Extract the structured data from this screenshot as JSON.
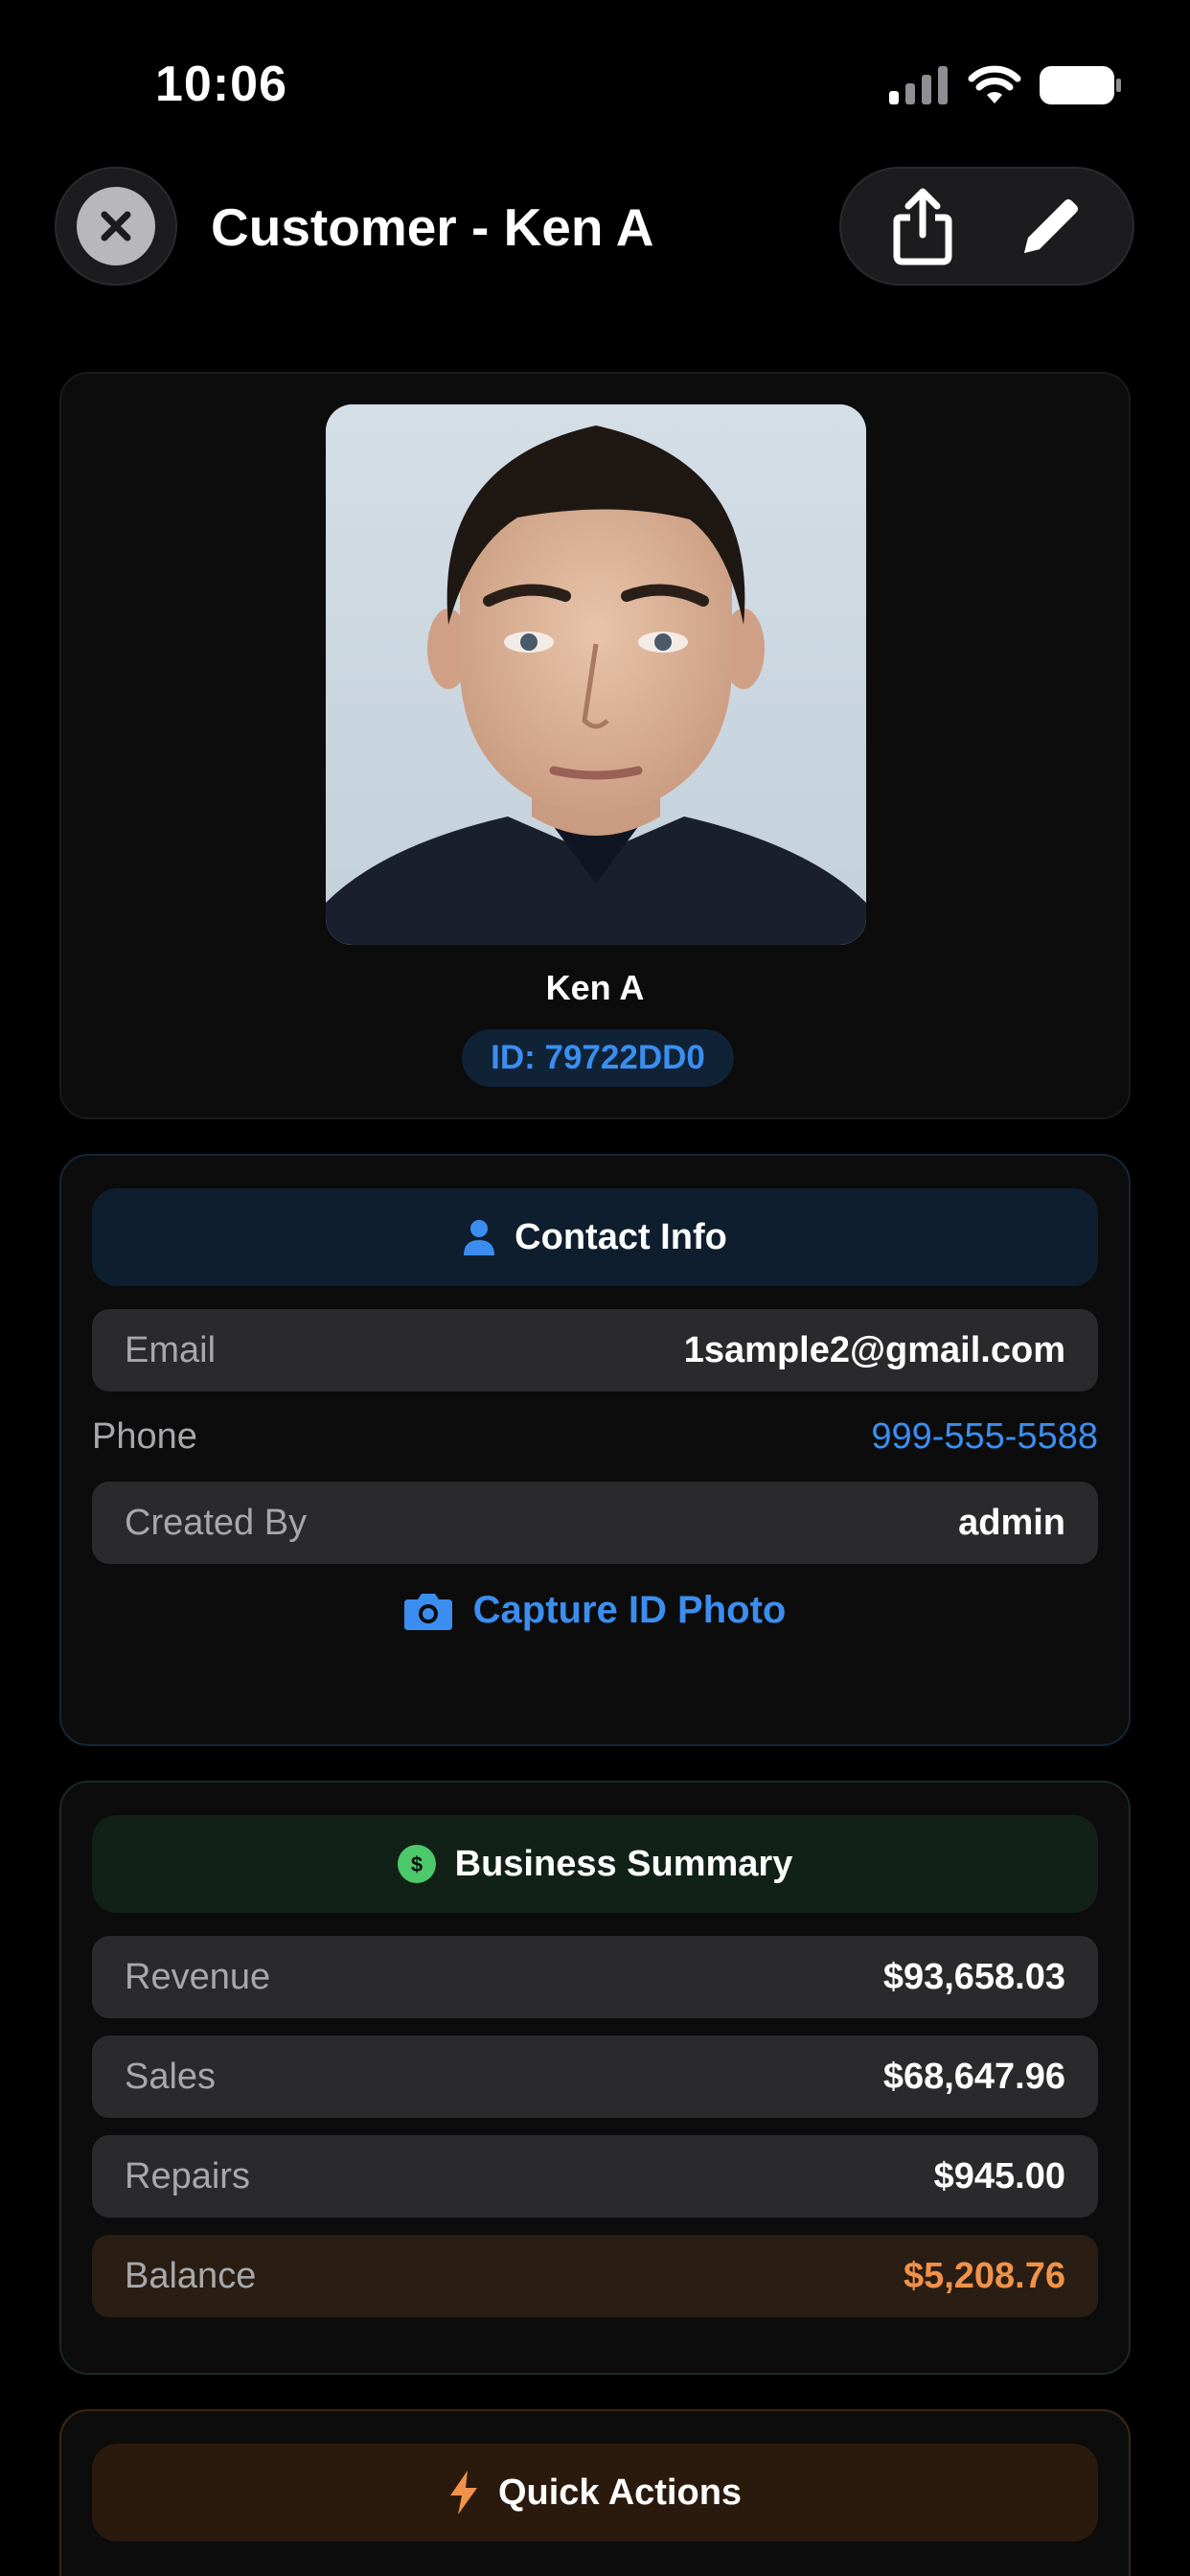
{
  "status_bar": {
    "time": "10:06"
  },
  "nav": {
    "title": "Customer - Ken A"
  },
  "profile": {
    "name": "Ken A",
    "id_label": "ID: 79722DD0"
  },
  "contact": {
    "header": "Contact Info",
    "rows": [
      {
        "label": "Email",
        "value": "1sample2@gmail.com"
      },
      {
        "label": "Phone",
        "value": "999-555-5588"
      },
      {
        "label": "Created By",
        "value": "admin"
      }
    ],
    "capture_label": "Capture ID Photo"
  },
  "business": {
    "header": "Business Summary",
    "rows": [
      {
        "label": "Revenue",
        "value": "$93,658.03"
      },
      {
        "label": "Sales",
        "value": "$68,647.96"
      },
      {
        "label": "Repairs",
        "value": "$945.00"
      },
      {
        "label": "Balance",
        "value": "$5,208.76"
      }
    ]
  },
  "quick_actions": {
    "header": "Quick Actions"
  },
  "colors": {
    "accent_blue": "#3b8ef0",
    "accent_green": "#4cc96a",
    "accent_orange": "#f0924a"
  }
}
